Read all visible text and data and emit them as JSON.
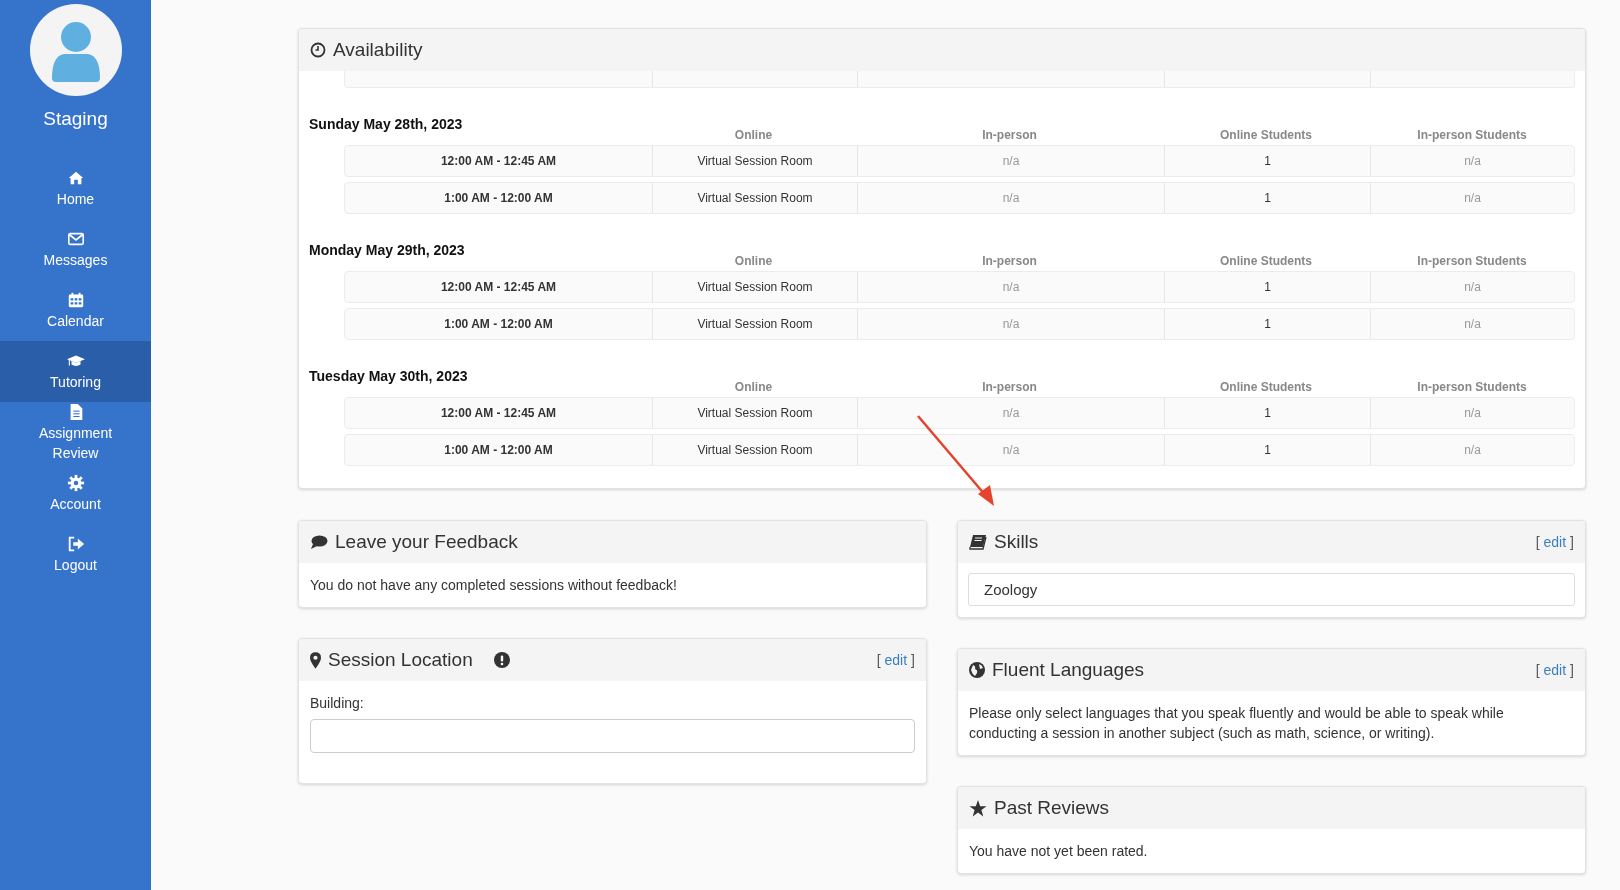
{
  "sidebar": {
    "profile_name": "Staging",
    "items": [
      {
        "label": "Home",
        "selected": false
      },
      {
        "label": "Messages",
        "selected": false
      },
      {
        "label": "Calendar",
        "selected": false
      },
      {
        "label": "Tutoring",
        "selected": true
      },
      {
        "label": "Assignment Review",
        "selected": false
      },
      {
        "label": "Account",
        "selected": false
      },
      {
        "label": "Logout",
        "selected": false
      }
    ]
  },
  "availability": {
    "title": "Availability",
    "days": [
      {
        "date": "Sunday May 28th, 2023",
        "columns": [
          "Online",
          "In-person",
          "Online Students",
          "In-person Students"
        ],
        "rows": [
          {
            "time": "12:00 AM - 12:45 AM",
            "online": "Virtual Session Room",
            "in_person": "n/a",
            "online_students": "1",
            "in_person_students": "n/a"
          },
          {
            "time": "1:00 AM - 12:00 AM",
            "online": "Virtual Session Room",
            "in_person": "n/a",
            "online_students": "1",
            "in_person_students": "n/a"
          }
        ]
      },
      {
        "date": "Monday May 29th, 2023",
        "columns": [
          "Online",
          "In-person",
          "Online Students",
          "In-person Students"
        ],
        "rows": [
          {
            "time": "12:00 AM - 12:45 AM",
            "online": "Virtual Session Room",
            "in_person": "n/a",
            "online_students": "1",
            "in_person_students": "n/a"
          },
          {
            "time": "1:00 AM - 12:00 AM",
            "online": "Virtual Session Room",
            "in_person": "n/a",
            "online_students": "1",
            "in_person_students": "n/a"
          }
        ]
      },
      {
        "date": "Tuesday May 30th, 2023",
        "columns": [
          "Online",
          "In-person",
          "Online Students",
          "In-person Students"
        ],
        "rows": [
          {
            "time": "12:00 AM - 12:45 AM",
            "online": "Virtual Session Room",
            "in_person": "n/a",
            "online_students": "1",
            "in_person_students": "n/a"
          },
          {
            "time": "1:00 AM - 12:00 AM",
            "online": "Virtual Session Room",
            "in_person": "n/a",
            "online_students": "1",
            "in_person_students": "n/a"
          }
        ]
      }
    ]
  },
  "feedback": {
    "title": "Leave your Feedback",
    "message": "You do not have any completed sessions without feedback!"
  },
  "session_location": {
    "title": "Session Location",
    "edit": {
      "open": "[",
      "label": "edit",
      "close": "]"
    },
    "field_label": "Building:"
  },
  "skills": {
    "title": "Skills",
    "edit": {
      "open": "[",
      "label": "edit",
      "close": "]"
    },
    "items": [
      "Zoology"
    ]
  },
  "fluent_languages": {
    "title": "Fluent Languages",
    "edit": {
      "open": "[",
      "label": "edit",
      "close": "]"
    },
    "message": "Please only select languages that you speak fluently and would be able to speak while conducting a session in another subject (such as math, science, or writing)."
  },
  "past_reviews": {
    "title": "Past Reviews",
    "message": "You have not yet been rated."
  }
}
